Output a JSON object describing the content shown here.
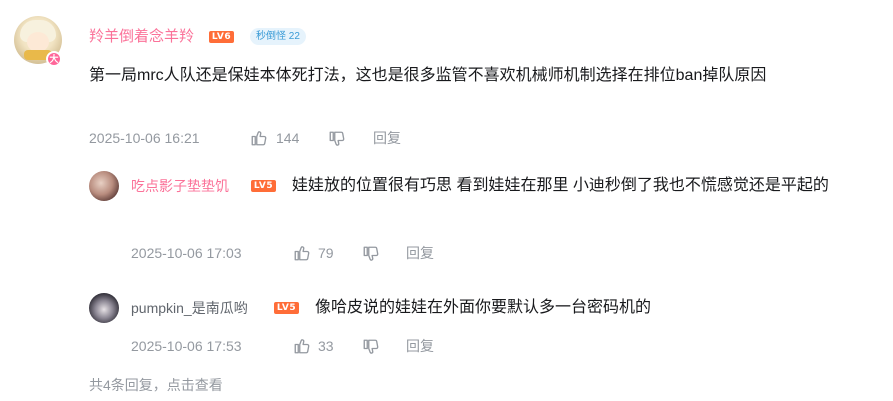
{
  "comment": {
    "username": "羚羊倒着念羊羚",
    "level": "LV6",
    "fan_badge": "秒倒怪 22",
    "avatar_badge": "大",
    "text": "第一局mrc人队还是保娃本体死打法，这也是很多监管不喜欢机械师机制选择在排位ban掉队原因",
    "time": "2025-10-06 16:21",
    "likes": "144",
    "reply_label": "回复"
  },
  "replies": [
    {
      "username": "吃点影子垫垫饥",
      "level": "LV5",
      "text": "娃娃放的位置很有巧思 看到娃娃在那里 小迪秒倒了我也不慌感觉还是平起的",
      "time": "2025-10-06 17:03",
      "likes": "79",
      "reply_label": "回复"
    },
    {
      "username": "pumpkin_是南瓜哟",
      "level": "LV5",
      "text": "像哈皮说的娃娃在外面你要默认多一台密码机的",
      "time": "2025-10-06 17:53",
      "likes": "33",
      "reply_label": "回复"
    }
  ],
  "footer": {
    "text": "共4条回复，点击查看"
  },
  "colors": {
    "username_pink": "#fb7299",
    "username_gray": "#61666d",
    "text": "#18191c",
    "meta": "#9499a0",
    "level_orange": "#ff6d38",
    "fan_badge_blue": "#3a9bd6"
  },
  "icons": {
    "like": "thumbs-up-icon",
    "dislike": "thumbs-down-icon"
  }
}
